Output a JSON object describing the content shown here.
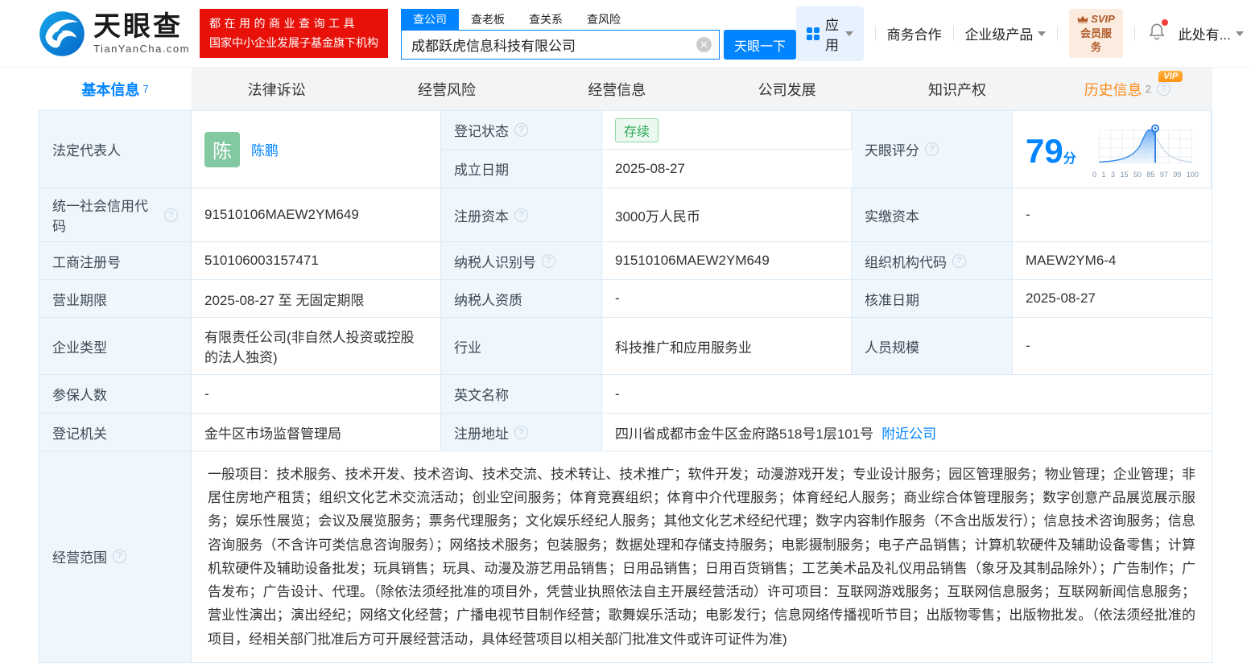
{
  "header": {
    "logo": {
      "title": "天眼查",
      "domain": "TianYanCha.com"
    },
    "slogan": {
      "line1": "都在用的商业查询工具",
      "line2": "国家中小企业发展子基金旗下机构"
    },
    "search": {
      "tabs": [
        {
          "label": "查公司"
        },
        {
          "label": "查老板"
        },
        {
          "label": "查关系"
        },
        {
          "label": "查风险"
        }
      ],
      "value": "成都跃虎信息科技有限公司",
      "button": "天眼一下"
    },
    "nav": {
      "apps_label": "应用",
      "coop": "商务合作",
      "enterprise": "企业级产品",
      "svip_line1": "SVIP",
      "svip_line2": "会员服务",
      "user": "此处有..."
    }
  },
  "tabs": [
    {
      "label": "基本信息",
      "count": "7"
    },
    {
      "label": "法律诉讼"
    },
    {
      "label": "经营风险"
    },
    {
      "label": "经营信息"
    },
    {
      "label": "公司发展"
    },
    {
      "label": "知识产权"
    },
    {
      "label": "历史信息",
      "count": "2",
      "vip": "VIP"
    }
  ],
  "info": {
    "legal_rep": {
      "label": "法定代表人",
      "avatar_char": "陈",
      "name": "陈鹏"
    },
    "reg_status": {
      "label": "登记状态",
      "value": "存续"
    },
    "establish_date": {
      "label": "成立日期",
      "value": "2025-08-27"
    },
    "score": {
      "label": "天眼评分",
      "value": "79",
      "unit": "分",
      "axis": [
        "0",
        "1",
        "3",
        "15",
        "50",
        "85",
        "97",
        "99",
        "100"
      ],
      "chart_color": "#3d8fe8"
    },
    "rows": [
      [
        {
          "label": "统一社会信用代码",
          "value": "91510106MAEW2YM649"
        },
        {
          "label": "注册资本",
          "value": "3000万人民币"
        },
        {
          "label": "实缴资本",
          "value": "-"
        }
      ],
      [
        {
          "label": "工商注册号",
          "value": "510106003157471"
        },
        {
          "label": "纳税人识别号",
          "value": "91510106MAEW2YM649"
        },
        {
          "label": "组织机构代码",
          "value": "MAEW2YM6-4"
        }
      ],
      [
        {
          "label": "营业期限",
          "value": "2025-08-27 至 无固定期限"
        },
        {
          "label": "纳税人资质",
          "value": "-"
        },
        {
          "label": "核准日期",
          "value": "2025-08-27"
        }
      ],
      [
        {
          "label": "企业类型",
          "value": "有限责任公司(非自然人投资或控股的法人独资)"
        },
        {
          "label": "行业",
          "value": "科技推广和应用服务业"
        },
        {
          "label": "人员规模",
          "value": "-"
        }
      ]
    ],
    "row_insured": {
      "label": "参保人数",
      "value": "-",
      "label2": "英文名称",
      "value2": "-"
    },
    "row_registry": {
      "label": "登记机关",
      "value": "金牛区市场监督管理局",
      "label2": "注册地址",
      "value2": "四川省成都市金牛区金府路518号1层101号",
      "nearby_link": "附近公司"
    },
    "scope": {
      "label": "经营范围",
      "value": "一般项目：技术服务、技术开发、技术咨询、技术交流、技术转让、技术推广；软件开发；动漫游戏开发；专业设计服务；园区管理服务；物业管理；企业管理；非居住房地产租赁；组织文化艺术交流活动；创业空间服务；体育竞赛组织；体育中介代理服务；体育经纪人服务；商业综合体管理服务；数字创意产品展览展示服务；娱乐性展览；会议及展览服务；票务代理服务；文化娱乐经纪人服务；其他文化艺术经纪代理；数字内容制作服务（不含出版发行）；信息技术咨询服务；信息咨询服务（不含许可类信息咨询服务）；网络技术服务；包装服务；数据处理和存储支持服务；电影摄制服务；电子产品销售；计算机软硬件及辅助设备零售；计算机软硬件及辅助设备批发；玩具销售；玩具、动漫及游艺用品销售；日用品销售；日用百货销售；工艺美术品及礼仪用品销售（象牙及其制品除外）；广告制作；广告发布；广告设计、代理。（除依法须经批准的项目外，凭营业执照依法自主开展经营活动）许可项目：互联网游戏服务；互联网信息服务；互联网新闻信息服务；营业性演出；演出经纪；网络文化经营；广播电视节目制作经营；歌舞娱乐活动；电影发行；信息网络传播视听节目；出版物零售；出版物批发。（依法须经批准的项目，经相关部门批准后方可开展经营活动，具体经营项目以相关部门批准文件或许可证件为准)"
    }
  }
}
